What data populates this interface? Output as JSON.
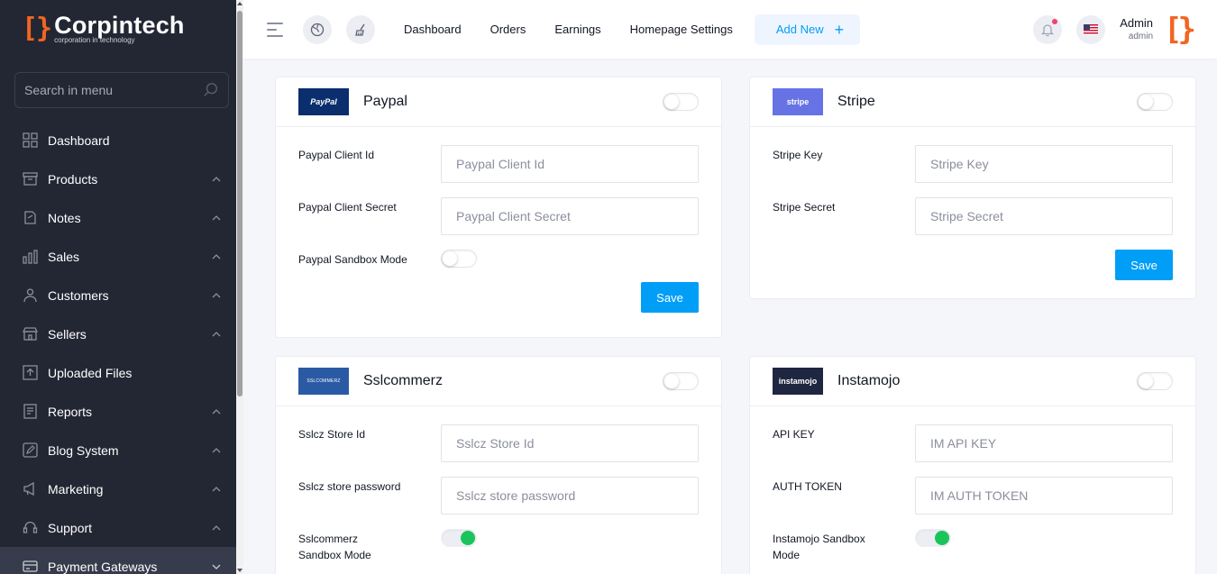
{
  "brand": {
    "name": "Corpintech",
    "tagline": "corporation in technology",
    "color": "#f26522"
  },
  "sidebar": {
    "search_placeholder": "Search in menu",
    "items": [
      {
        "label": "Dashboard",
        "icon": "dashboard-icon",
        "has_children": false
      },
      {
        "label": "Products",
        "icon": "products-icon",
        "has_children": true
      },
      {
        "label": "Notes",
        "icon": "notes-icon",
        "has_children": true
      },
      {
        "label": "Sales",
        "icon": "sales-icon",
        "has_children": true
      },
      {
        "label": "Customers",
        "icon": "customers-icon",
        "has_children": true
      },
      {
        "label": "Sellers",
        "icon": "sellers-icon",
        "has_children": true
      },
      {
        "label": "Uploaded Files",
        "icon": "upload-icon",
        "has_children": false
      },
      {
        "label": "Reports",
        "icon": "reports-icon",
        "has_children": true
      },
      {
        "label": "Blog System",
        "icon": "blog-icon",
        "has_children": true
      },
      {
        "label": "Marketing",
        "icon": "marketing-icon",
        "has_children": true
      },
      {
        "label": "Support",
        "icon": "support-icon",
        "has_children": true
      },
      {
        "label": "Payment Gateways",
        "icon": "payment-icon",
        "has_children": true,
        "active": true
      }
    ]
  },
  "topbar": {
    "nav": [
      "Dashboard",
      "Orders",
      "Earnings",
      "Homepage Settings"
    ],
    "add_new": "Add New",
    "user_name": "Admin",
    "user_role": "admin",
    "accent": "#009ef7"
  },
  "gateways": {
    "paypal": {
      "title": "Paypal",
      "logo_text": "PayPal",
      "enabled": false,
      "fields": [
        {
          "label": "Paypal Client Id",
          "placeholder": "Paypal Client Id",
          "value": ""
        },
        {
          "label": "Paypal Client Secret",
          "placeholder": "Paypal Client Secret",
          "value": ""
        }
      ],
      "sandbox_label": "Paypal Sandbox Mode",
      "sandbox": false,
      "save": "Save"
    },
    "stripe": {
      "title": "Stripe",
      "logo_text": "stripe",
      "enabled": false,
      "fields": [
        {
          "label": "Stripe Key",
          "placeholder": "Stripe Key",
          "value": ""
        },
        {
          "label": "Stripe Secret",
          "placeholder": "Stripe Secret",
          "value": ""
        }
      ],
      "save": "Save"
    },
    "sslcommerz": {
      "title": "Sslcommerz",
      "logo_text": "SSLCOMMERZ",
      "enabled": false,
      "fields": [
        {
          "label": "Sslcz Store Id",
          "placeholder": "Sslcz Store Id",
          "value": ""
        },
        {
          "label": "Sslcz store password",
          "placeholder": "Sslcz store password",
          "value": ""
        }
      ],
      "sandbox_label": "Sslcommerz Sandbox Mode",
      "sandbox": true
    },
    "instamojo": {
      "title": "Instamojo",
      "logo_text": "instamojo",
      "enabled": false,
      "fields": [
        {
          "label": "API KEY",
          "placeholder": "IM API KEY",
          "value": ""
        },
        {
          "label": "AUTH TOKEN",
          "placeholder": "IM AUTH TOKEN",
          "value": ""
        }
      ],
      "sandbox_label": "Instamojo Sandbox Mode",
      "sandbox": true
    }
  }
}
